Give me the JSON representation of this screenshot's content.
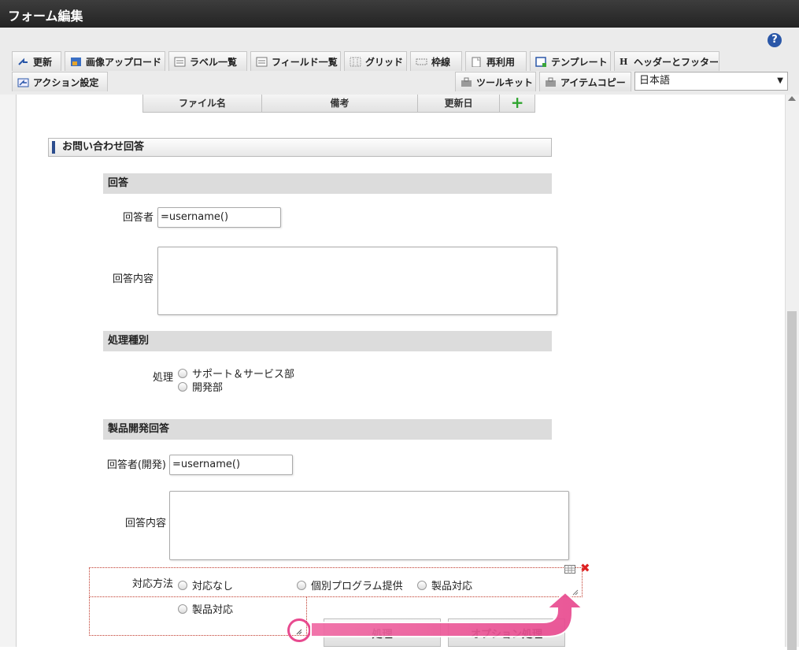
{
  "window": {
    "title": "フォーム編集"
  },
  "toolbar": {
    "help_label": "?",
    "row1": [
      {
        "label": "更新",
        "icon": "update-icon"
      },
      {
        "label": "画像アップロード",
        "icon": "image-upload-icon"
      },
      {
        "label": "ラベル一覧",
        "icon": "label-list-icon"
      },
      {
        "label": "フィールド一覧",
        "icon": "field-list-icon"
      },
      {
        "label": "グリッド",
        "icon": "grid-icon"
      },
      {
        "label": "枠線",
        "icon": "border-icon"
      },
      {
        "label": "再利用",
        "icon": "reuse-icon"
      },
      {
        "label": "テンプレート",
        "icon": "template-icon"
      },
      {
        "label": "ヘッダーとフッター",
        "icon": "header-footer-icon"
      }
    ],
    "row2_left": {
      "label": "アクション設定",
      "icon": "action-settings-icon"
    },
    "toolkit": {
      "label": "ツールキット",
      "icon": "toolkit-icon"
    },
    "item_copy": {
      "label": "アイテムコピー",
      "icon": "item-copy-icon"
    },
    "language": {
      "selected": "日本語"
    }
  },
  "file_table": {
    "headers": [
      "ファイル名",
      "備考",
      "更新日"
    ],
    "add_label": "+"
  },
  "form": {
    "section_title": "お問い合わせ回答",
    "answer": {
      "heading": "回答",
      "answerer_label": "回答者",
      "answerer_value": "=username()",
      "content_label": "回答内容"
    },
    "process": {
      "heading": "処理種別",
      "label": "処理",
      "options": [
        "サポート＆サービス部",
        "開発部"
      ]
    },
    "dev_answer": {
      "heading": "製品開発回答",
      "answerer_label": "回答者(開発)",
      "answerer_value": "=username()",
      "content_label": "回答内容"
    },
    "response": {
      "label": "対応方法",
      "options": [
        "対応なし",
        "個別プログラム提供",
        "製品対応"
      ],
      "extra_option": "製品対応"
    },
    "buttons": {
      "process": "処理",
      "option_process": "オプション処理"
    }
  },
  "colors": {
    "highlight": "#e84a8f",
    "accent": "#2c4d8e",
    "plus": "#2fa52f",
    "delete": "#dd2222"
  }
}
